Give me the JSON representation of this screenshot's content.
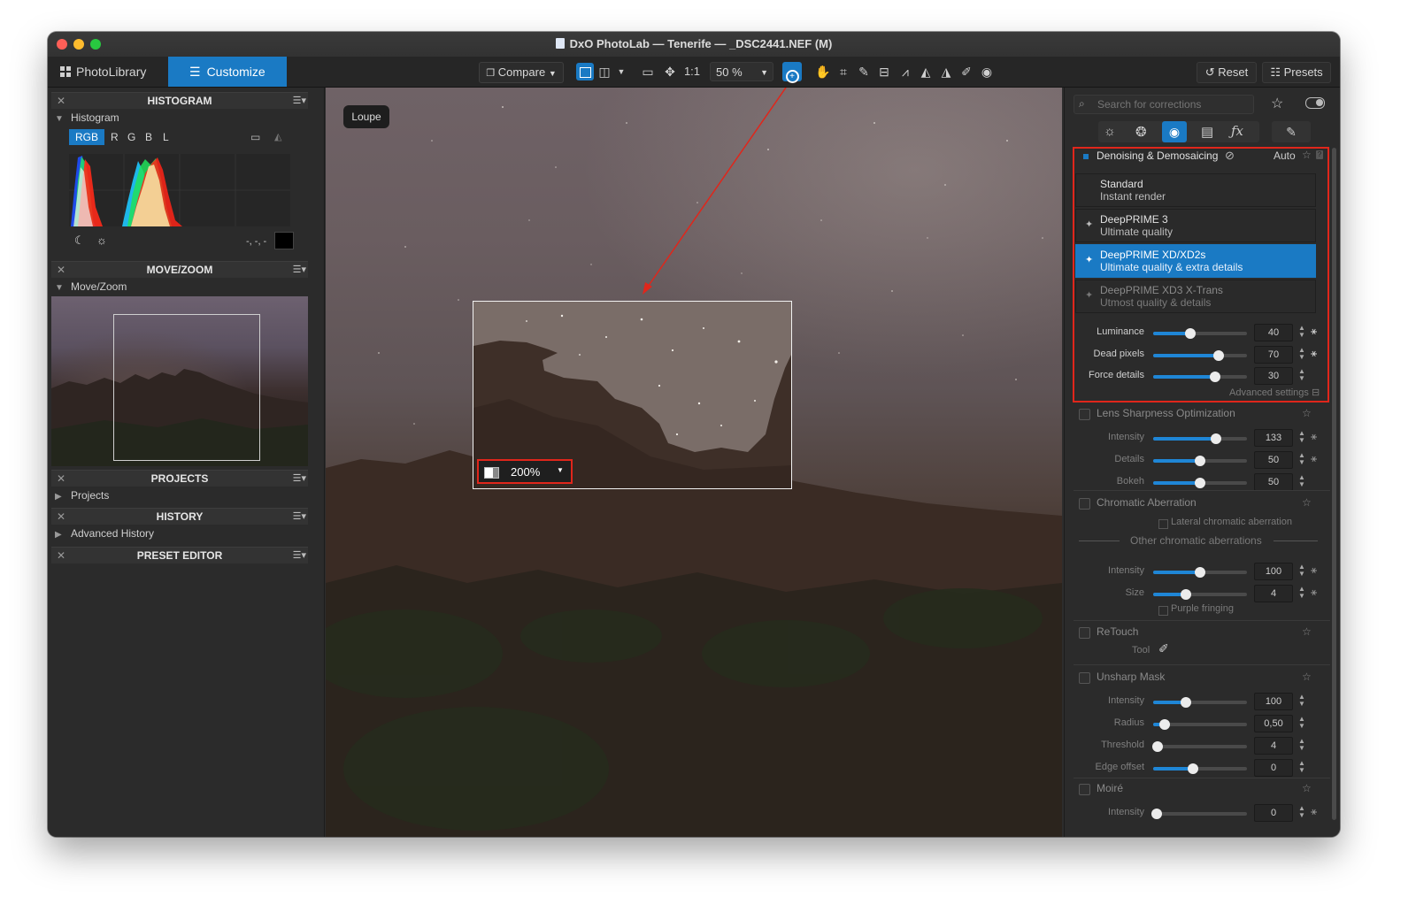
{
  "window": {
    "title": "DxO PhotoLab — Tenerife — _DSC2441.NEF (M)"
  },
  "toolbar": {
    "tabs": [
      {
        "label": "PhotoLibrary"
      },
      {
        "label": "Customize"
      }
    ],
    "compare_label": "Compare",
    "one_to_one": "1:1",
    "zoom": "50 %",
    "reset_label": "Reset",
    "presets_label": "Presets"
  },
  "left": {
    "histogram": {
      "header": "HISTOGRAM",
      "sub": "Histogram",
      "channels": [
        "RGB",
        "R",
        "G",
        "B",
        "L"
      ],
      "readout": "-, -, -"
    },
    "movezoom": {
      "header": "MOVE/ZOOM",
      "sub": "Move/Zoom"
    },
    "projects": {
      "header": "PROJECTS",
      "sub": "Projects"
    },
    "history": {
      "header": "HISTORY",
      "sub": "Advanced History"
    },
    "preset_editor": {
      "header": "PRESET EDITOR"
    }
  },
  "canvas": {
    "loupe_badge": "Loupe",
    "loupe_zoom": "200%"
  },
  "right": {
    "search": {
      "placeholder": "Search for corrections"
    },
    "denoise": {
      "title": "Denoising & Demosaicing",
      "mode": "Auto",
      "options": [
        {
          "l1": "Standard",
          "l2": "Instant render"
        },
        {
          "l1": "DeepPRIME 3",
          "l2": "Ultimate quality"
        },
        {
          "l1": "DeepPRIME XD/XD2s",
          "l2": "Ultimate quality & extra details"
        },
        {
          "l1": "DeepPRIME XD3 X-Trans",
          "l2": "Utmost quality & details"
        }
      ],
      "luminance": {
        "label": "Luminance",
        "value": "40"
      },
      "dead_pixels": {
        "label": "Dead pixels",
        "value": "70"
      },
      "force_details": {
        "label": "Force details",
        "value": "30"
      },
      "advanced": "Advanced settings"
    },
    "lens_sharpness": {
      "title": "Lens Sharpness Optimization",
      "intensity": {
        "label": "Intensity",
        "value": "133"
      },
      "details": {
        "label": "Details",
        "value": "50"
      },
      "bokeh": {
        "label": "Bokeh",
        "value": "50"
      }
    },
    "chromatic": {
      "title": "Chromatic Aberration",
      "lateral": "Lateral chromatic aberration",
      "other": "Other chromatic aberrations",
      "intensity": {
        "label": "Intensity",
        "value": "100"
      },
      "size": {
        "label": "Size",
        "value": "4"
      },
      "purple": "Purple fringing"
    },
    "retouch": {
      "title": "ReTouch",
      "tool": "Tool"
    },
    "unsharp": {
      "title": "Unsharp Mask",
      "intensity": {
        "label": "Intensity",
        "value": "100"
      },
      "radius": {
        "label": "Radius",
        "value": "0,50"
      },
      "threshold": {
        "label": "Threshold",
        "value": "4"
      },
      "edge": {
        "label": "Edge offset",
        "value": "0"
      }
    },
    "moire": {
      "title": "Moiré",
      "intensity": {
        "label": "Intensity",
        "value": "0"
      }
    }
  },
  "colors": {
    "accent": "#1a7ac4",
    "highlight_box": "#e0261b",
    "arrow": "#e0261b"
  }
}
